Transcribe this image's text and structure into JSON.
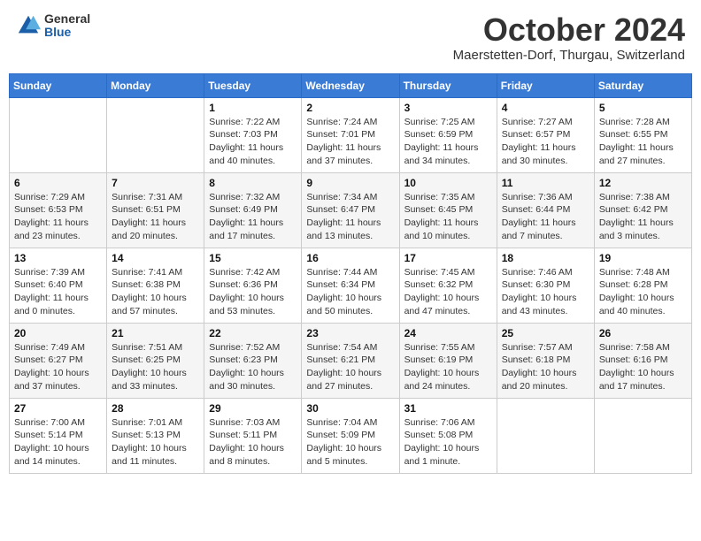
{
  "header": {
    "logo_general": "General",
    "logo_blue": "Blue",
    "month": "October 2024",
    "location": "Maerstetten-Dorf, Thurgau, Switzerland"
  },
  "weekdays": [
    "Sunday",
    "Monday",
    "Tuesday",
    "Wednesday",
    "Thursday",
    "Friday",
    "Saturday"
  ],
  "weeks": [
    [
      {
        "day": "",
        "info": ""
      },
      {
        "day": "",
        "info": ""
      },
      {
        "day": "1",
        "info": "Sunrise: 7:22 AM\nSunset: 7:03 PM\nDaylight: 11 hours and 40 minutes."
      },
      {
        "day": "2",
        "info": "Sunrise: 7:24 AM\nSunset: 7:01 PM\nDaylight: 11 hours and 37 minutes."
      },
      {
        "day": "3",
        "info": "Sunrise: 7:25 AM\nSunset: 6:59 PM\nDaylight: 11 hours and 34 minutes."
      },
      {
        "day": "4",
        "info": "Sunrise: 7:27 AM\nSunset: 6:57 PM\nDaylight: 11 hours and 30 minutes."
      },
      {
        "day": "5",
        "info": "Sunrise: 7:28 AM\nSunset: 6:55 PM\nDaylight: 11 hours and 27 minutes."
      }
    ],
    [
      {
        "day": "6",
        "info": "Sunrise: 7:29 AM\nSunset: 6:53 PM\nDaylight: 11 hours and 23 minutes."
      },
      {
        "day": "7",
        "info": "Sunrise: 7:31 AM\nSunset: 6:51 PM\nDaylight: 11 hours and 20 minutes."
      },
      {
        "day": "8",
        "info": "Sunrise: 7:32 AM\nSunset: 6:49 PM\nDaylight: 11 hours and 17 minutes."
      },
      {
        "day": "9",
        "info": "Sunrise: 7:34 AM\nSunset: 6:47 PM\nDaylight: 11 hours and 13 minutes."
      },
      {
        "day": "10",
        "info": "Sunrise: 7:35 AM\nSunset: 6:45 PM\nDaylight: 11 hours and 10 minutes."
      },
      {
        "day": "11",
        "info": "Sunrise: 7:36 AM\nSunset: 6:44 PM\nDaylight: 11 hours and 7 minutes."
      },
      {
        "day": "12",
        "info": "Sunrise: 7:38 AM\nSunset: 6:42 PM\nDaylight: 11 hours and 3 minutes."
      }
    ],
    [
      {
        "day": "13",
        "info": "Sunrise: 7:39 AM\nSunset: 6:40 PM\nDaylight: 11 hours and 0 minutes."
      },
      {
        "day": "14",
        "info": "Sunrise: 7:41 AM\nSunset: 6:38 PM\nDaylight: 10 hours and 57 minutes."
      },
      {
        "day": "15",
        "info": "Sunrise: 7:42 AM\nSunset: 6:36 PM\nDaylight: 10 hours and 53 minutes."
      },
      {
        "day": "16",
        "info": "Sunrise: 7:44 AM\nSunset: 6:34 PM\nDaylight: 10 hours and 50 minutes."
      },
      {
        "day": "17",
        "info": "Sunrise: 7:45 AM\nSunset: 6:32 PM\nDaylight: 10 hours and 47 minutes."
      },
      {
        "day": "18",
        "info": "Sunrise: 7:46 AM\nSunset: 6:30 PM\nDaylight: 10 hours and 43 minutes."
      },
      {
        "day": "19",
        "info": "Sunrise: 7:48 AM\nSunset: 6:28 PM\nDaylight: 10 hours and 40 minutes."
      }
    ],
    [
      {
        "day": "20",
        "info": "Sunrise: 7:49 AM\nSunset: 6:27 PM\nDaylight: 10 hours and 37 minutes."
      },
      {
        "day": "21",
        "info": "Sunrise: 7:51 AM\nSunset: 6:25 PM\nDaylight: 10 hours and 33 minutes."
      },
      {
        "day": "22",
        "info": "Sunrise: 7:52 AM\nSunset: 6:23 PM\nDaylight: 10 hours and 30 minutes."
      },
      {
        "day": "23",
        "info": "Sunrise: 7:54 AM\nSunset: 6:21 PM\nDaylight: 10 hours and 27 minutes."
      },
      {
        "day": "24",
        "info": "Sunrise: 7:55 AM\nSunset: 6:19 PM\nDaylight: 10 hours and 24 minutes."
      },
      {
        "day": "25",
        "info": "Sunrise: 7:57 AM\nSunset: 6:18 PM\nDaylight: 10 hours and 20 minutes."
      },
      {
        "day": "26",
        "info": "Sunrise: 7:58 AM\nSunset: 6:16 PM\nDaylight: 10 hours and 17 minutes."
      }
    ],
    [
      {
        "day": "27",
        "info": "Sunrise: 7:00 AM\nSunset: 5:14 PM\nDaylight: 10 hours and 14 minutes."
      },
      {
        "day": "28",
        "info": "Sunrise: 7:01 AM\nSunset: 5:13 PM\nDaylight: 10 hours and 11 minutes."
      },
      {
        "day": "29",
        "info": "Sunrise: 7:03 AM\nSunset: 5:11 PM\nDaylight: 10 hours and 8 minutes."
      },
      {
        "day": "30",
        "info": "Sunrise: 7:04 AM\nSunset: 5:09 PM\nDaylight: 10 hours and 5 minutes."
      },
      {
        "day": "31",
        "info": "Sunrise: 7:06 AM\nSunset: 5:08 PM\nDaylight: 10 hours and 1 minute."
      },
      {
        "day": "",
        "info": ""
      },
      {
        "day": "",
        "info": ""
      }
    ]
  ]
}
